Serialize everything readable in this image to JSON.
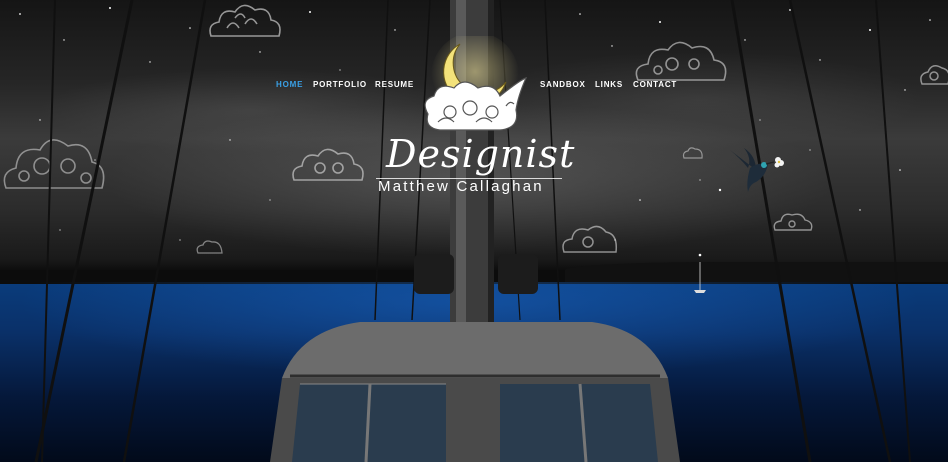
{
  "nav": {
    "items": [
      {
        "label": "HOME",
        "active": true
      },
      {
        "label": "PORTFOLIO",
        "active": false
      },
      {
        "label": "RESUME",
        "active": false
      },
      {
        "label": "SANDBOX",
        "active": false
      },
      {
        "label": "LINKS",
        "active": false
      },
      {
        "label": "CONTACT",
        "active": false
      }
    ]
  },
  "brand": {
    "title": "Designist",
    "subtitle": "Matthew Callaghan"
  },
  "colors": {
    "nav_text": "#ffffff",
    "nav_active": "#3aa0e6",
    "moon": "#f3e27a",
    "water": "#0a3c7c"
  },
  "icons": [
    "moon-cloud-logo-icon",
    "cloud-icon",
    "hummingbird-icon"
  ]
}
